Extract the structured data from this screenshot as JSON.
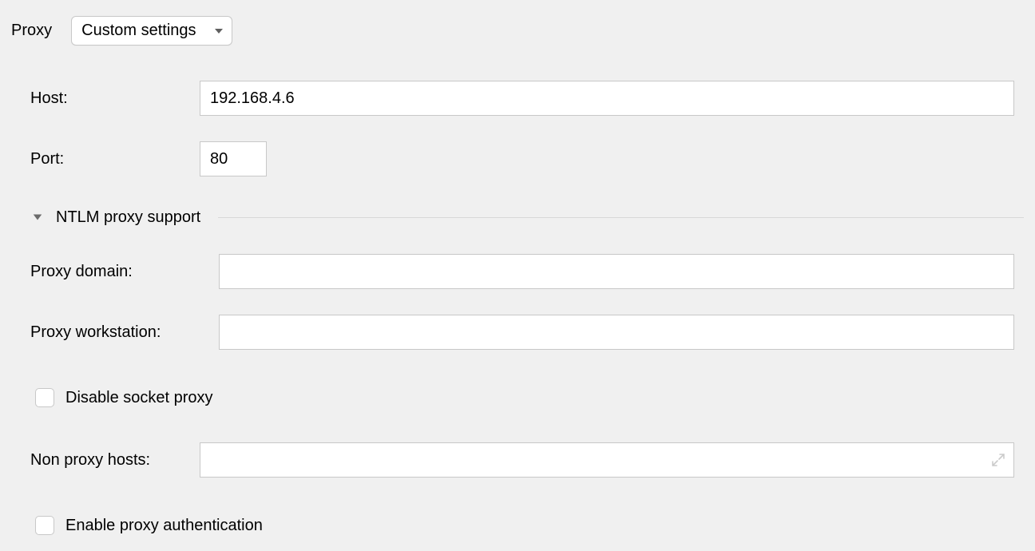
{
  "proxy_label": "Proxy",
  "mode_select": {
    "value": "Custom settings"
  },
  "host": {
    "label": "Host:",
    "value": "192.168.4.6"
  },
  "port": {
    "label": "Port:",
    "value": "80"
  },
  "ntlm_section": {
    "title": "NTLM proxy support",
    "domain": {
      "label": "Proxy domain:",
      "value": ""
    },
    "workstation": {
      "label": "Proxy workstation:",
      "value": ""
    }
  },
  "disable_socket": {
    "label": "Disable socket proxy",
    "checked": false
  },
  "non_proxy_hosts": {
    "label": "Non proxy hosts:",
    "value": ""
  },
  "enable_auth": {
    "label": "Enable proxy authentication",
    "checked": false
  }
}
